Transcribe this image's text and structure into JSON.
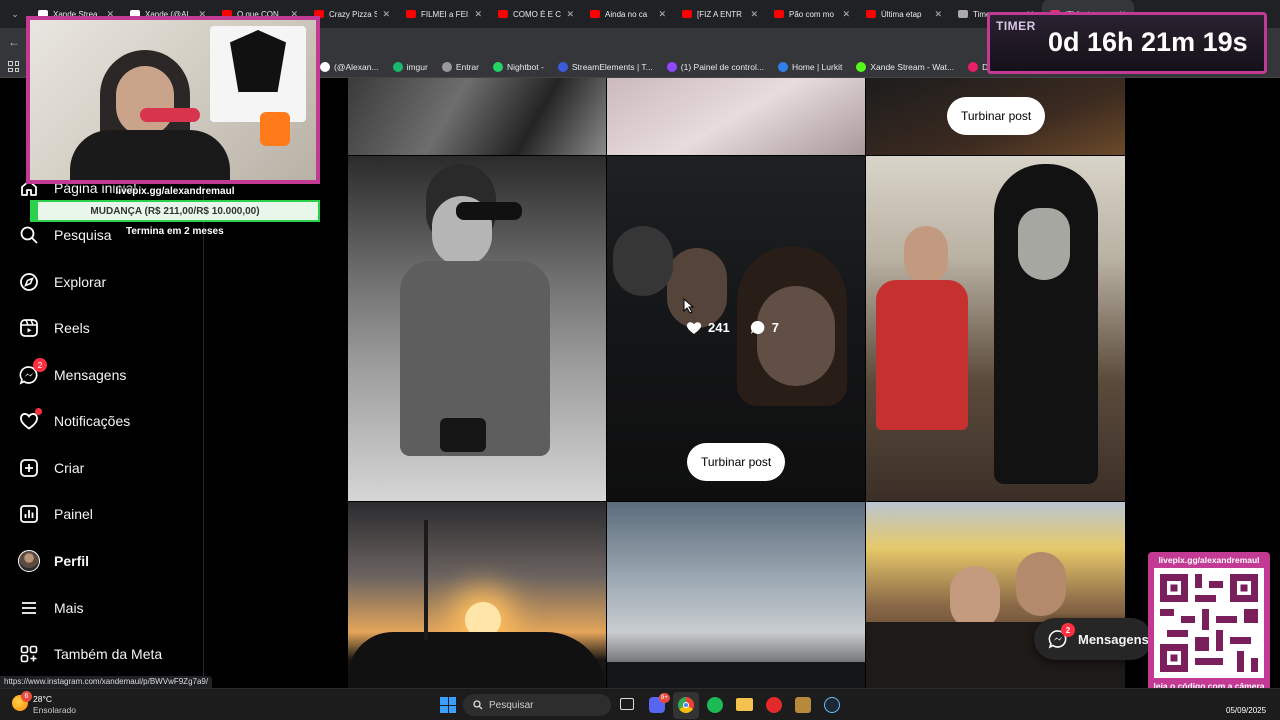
{
  "browser": {
    "tabs": [
      {
        "title": "Xande Strea",
        "color": "#ffffff"
      },
      {
        "title": "Xande (@Al",
        "color": "#ffffff"
      },
      {
        "title": "O que CON",
        "color": "#ff0000"
      },
      {
        "title": "Crazy Pizza S",
        "color": "#ff0000"
      },
      {
        "title": "FILMEI a FEI",
        "color": "#ff0000"
      },
      {
        "title": "COMO É E C",
        "color": "#ff0000"
      },
      {
        "title": "Ainda no ca",
        "color": "#ff0000"
      },
      {
        "title": "[FIZ A ENTR",
        "color": "#ff0000"
      },
      {
        "title": "Pão com mo",
        "color": "#ff0000"
      },
      {
        "title": "Última etap",
        "color": "#ff0000"
      },
      {
        "title": "Time",
        "color": "#aaaaaa"
      },
      {
        "title": "(2) Insta",
        "color": "#e1306c"
      }
    ],
    "bookmarks": [
      {
        "label": "(@Alexan...",
        "color": "#ffffff"
      },
      {
        "label": "imgur",
        "color": "#1bb76e"
      },
      {
        "label": "Entrar",
        "color": "#999999"
      },
      {
        "label": "Nightbot -",
        "color": "#25d366"
      },
      {
        "label": "StreamElements | T...",
        "color": "#3b5bdb"
      },
      {
        "label": "(1) Painel de control...",
        "color": "#9146ff"
      },
      {
        "label": "Home | Lurkit",
        "color": "#2f80ed"
      },
      {
        "label": "Xande Stream - Wat...",
        "color": "#53fc18"
      },
      {
        "label": "Discover C",
        "color": "#e91e63"
      }
    ]
  },
  "sidebar": {
    "items": [
      {
        "label": "Página inicial",
        "icon": "home-icon",
        "name": "sidebar-item-home"
      },
      {
        "label": "Pesquisa",
        "icon": "search-icon",
        "name": "sidebar-item-search"
      },
      {
        "label": "Explorar",
        "icon": "compass-icon",
        "name": "sidebar-item-explore"
      },
      {
        "label": "Reels",
        "icon": "reels-icon",
        "name": "sidebar-item-reels"
      },
      {
        "label": "Mensagens",
        "icon": "messenger-icon",
        "name": "sidebar-item-messages",
        "badge": "2"
      },
      {
        "label": "Notificações",
        "icon": "heart-icon",
        "name": "sidebar-item-notifications"
      },
      {
        "label": "Criar",
        "icon": "plus-square-icon",
        "name": "sidebar-item-create"
      },
      {
        "label": "Painel",
        "icon": "dashboard-icon",
        "name": "sidebar-item-dashboard"
      },
      {
        "label": "Perfil",
        "icon": "avatar-icon",
        "name": "sidebar-item-profile"
      },
      {
        "label": "Mais",
        "icon": "menu-icon",
        "name": "sidebar-item-more"
      },
      {
        "label": "Também da Meta",
        "icon": "meta-apps-icon",
        "name": "sidebar-item-also-from-meta"
      }
    ]
  },
  "grid": {
    "boost_label": "Turbinar post",
    "hover_stats": {
      "likes": "241",
      "comments": "7"
    }
  },
  "floating_messages": {
    "label": "Mensagens",
    "badge": "2"
  },
  "stream": {
    "donation_url": "livepix.gg/alexandremaul",
    "goal_text": "MUDANÇA (R$ 211,00/R$ 10.000,00)",
    "goal_progress": 0.0211,
    "goal_ends": "Termina em 2 meses",
    "timer_label": "TIMER",
    "timer_value": "0d 16h 21m 19s",
    "qr_url": "livepix.gg/alexandremaul",
    "qr_caption": "leia o código com a câmera do celular."
  },
  "status_url": "https://www.instagram.com/xandemaul/p/BWVwF9Zg7a9/",
  "taskbar": {
    "weather_temp": "28°C",
    "weather_desc": "Ensolarado",
    "weather_badge": "6",
    "search_placeholder": "Pesquisar",
    "discord_badge": "9+",
    "date": "05/09/2025"
  }
}
